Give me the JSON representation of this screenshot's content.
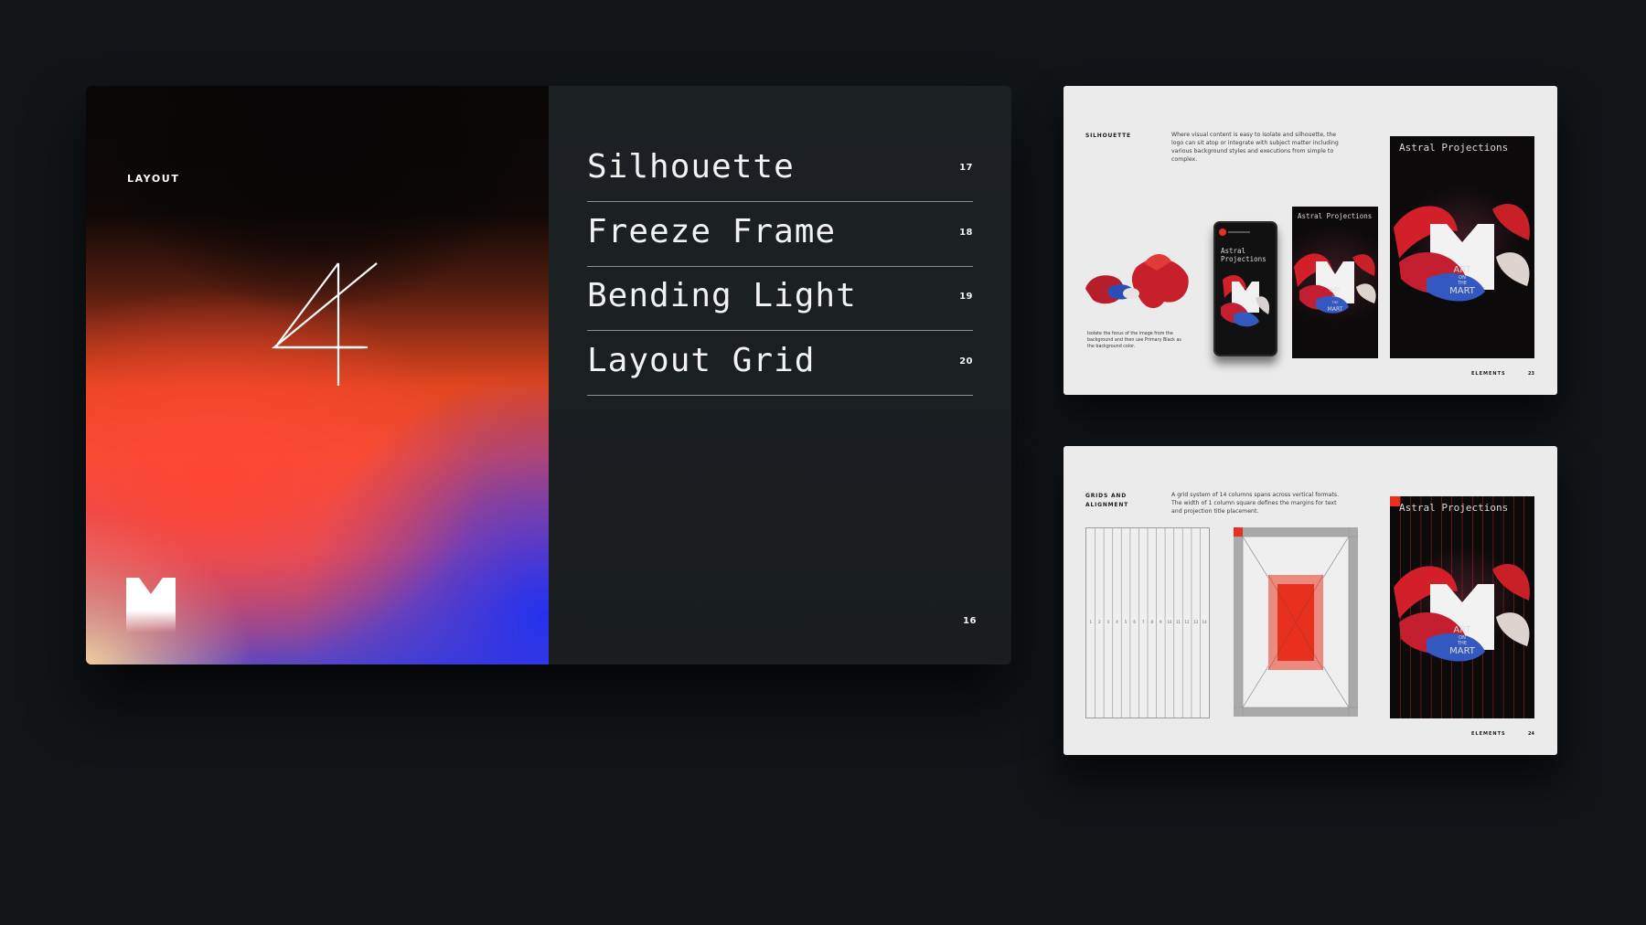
{
  "spread": {
    "section_label": "LAYOUT",
    "chapter_number": "4",
    "page_number": "16",
    "toc": [
      {
        "title": "Silhouette",
        "page": "17"
      },
      {
        "title": "Freeze Frame",
        "page": "18"
      },
      {
        "title": "Bending Light",
        "page": "19"
      },
      {
        "title": "Layout Grid",
        "page": "20"
      }
    ]
  },
  "card_silhouette": {
    "label": "SILHOUETTE",
    "description": "Where visual content is easy to isolate and silhouette, the logo can sit atop or integrate with subject matter including various background styles and executions from simple to complex.",
    "caption": "Isolate the focus of the image from the background and then use Primary Black as the background color.",
    "phone_title": "Astral Projections",
    "poster_small_title": "Astral Projections",
    "poster_large_title": "Astral Projections",
    "art_word": "ART",
    "on_word": "ON",
    "the_word": "THE",
    "mart_word": "MART",
    "footer_label": "ELEMENTS",
    "footer_page": "23"
  },
  "card_grids": {
    "label_line1": "GRIDS AND",
    "label_line2": "ALIGNMENT",
    "description": "A grid system of 14 columns spans across vertical formats. The width of 1 column square defines the margins for text and projection title placement.",
    "column_numbers": [
      "1",
      "2",
      "3",
      "4",
      "5",
      "6",
      "7",
      "8",
      "9",
      "10",
      "11",
      "12",
      "13",
      "14"
    ],
    "poster_title": "Astral Projections",
    "art_word": "ART",
    "on_word": "ON",
    "the_word": "THE",
    "mart_word": "MART",
    "footer_label": "ELEMENTS",
    "footer_page": "24"
  },
  "colors": {
    "background": "#111518",
    "accent_red": "#e8301f",
    "accent_blue": "#2432ee",
    "card_bg": "#ebebeb"
  }
}
